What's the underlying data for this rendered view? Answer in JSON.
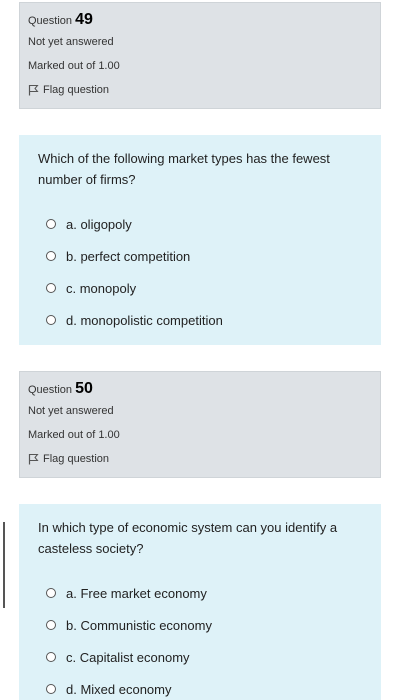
{
  "questions": [
    {
      "label": "Question",
      "number": "49",
      "state": "Not yet answered",
      "marks": "Marked out of 1.00",
      "flag_label": "Flag question",
      "text": "Which of the following market types has the fewest number of firms?",
      "options": [
        "a. oligopoly",
        "b. perfect competition",
        "c. monopoly",
        "d. monopolistic competition"
      ]
    },
    {
      "label": "Question",
      "number": "50",
      "state": "Not yet answered",
      "marks": "Marked out of 1.00",
      "flag_label": "Flag question",
      "text": "In which type of economic system can you identify a casteless society?",
      "options": [
        "a. Free market economy",
        "b. Communistic economy",
        "c. Capitalist economy",
        "d. Mixed economy"
      ]
    }
  ],
  "icons": {
    "flag": "flag-icon",
    "radio": "radio-unchecked-icon"
  },
  "colors": {
    "info_bg": "#dee2e6",
    "content_bg": "#def2f8"
  }
}
